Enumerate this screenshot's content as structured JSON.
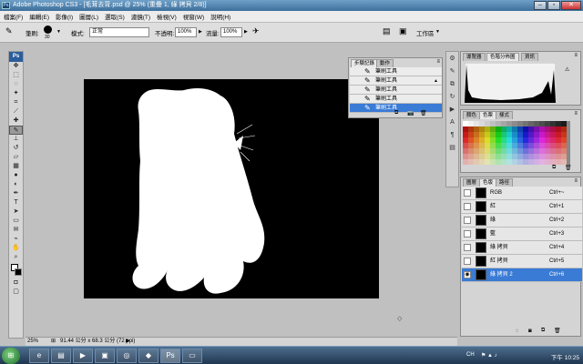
{
  "window": {
    "title": "Adobe Photoshop CS3 - [毛茸去背.psd @ 25% (重疊 1, 綠 拷貝 2/8)]",
    "app_badge": "Ps"
  },
  "menu": [
    "檔案(F)",
    "編輯(E)",
    "影像(I)",
    "圖層(L)",
    "選取(S)",
    "濾鏡(T)",
    "檢視(V)",
    "視窗(W)",
    "說明(H)"
  ],
  "options": {
    "brush_label": "筆刷:",
    "brush_size": "30",
    "mode_label": "模式:",
    "mode_value": "正常",
    "opacity_label": "不透明:",
    "opacity_value": "100%",
    "flow_label": "流量:",
    "flow_value": "100%",
    "workspace_label": "工作區"
  },
  "history": {
    "tabs": [
      "步驟記錄",
      "動作"
    ],
    "items": [
      "筆刷工具",
      "筆刷工具",
      "筆刷工具",
      "筆刷工具",
      "筆刷工具"
    ]
  },
  "navigator": {
    "tabs": [
      "導覽器",
      "色階分佈圖",
      "資訊"
    ]
  },
  "swatches": {
    "tabs": [
      "顏色",
      "色票",
      "樣式"
    ]
  },
  "channels": {
    "tabs": [
      "圖層",
      "色版",
      "路徑"
    ],
    "rows": [
      {
        "name": "RGB",
        "shortcut": "Ctrl+~"
      },
      {
        "name": "紅",
        "shortcut": "Ctrl+1"
      },
      {
        "name": "綠",
        "shortcut": "Ctrl+2"
      },
      {
        "name": "藍",
        "shortcut": "Ctrl+3"
      },
      {
        "name": "綠 拷貝",
        "shortcut": "Ctrl+4"
      },
      {
        "name": "紅 拷貝",
        "shortcut": "Ctrl+5"
      },
      {
        "name": "綠 拷貝 2",
        "shortcut": "Ctrl+6"
      }
    ]
  },
  "status": {
    "zoom": "25%",
    "doc_size": "91.44 公分 x 68.3 公分 (72 ppi)"
  },
  "taskbar": {
    "lang": "CH",
    "clock": "下午 10:25",
    "start_icon": "windows-orb-icon"
  }
}
